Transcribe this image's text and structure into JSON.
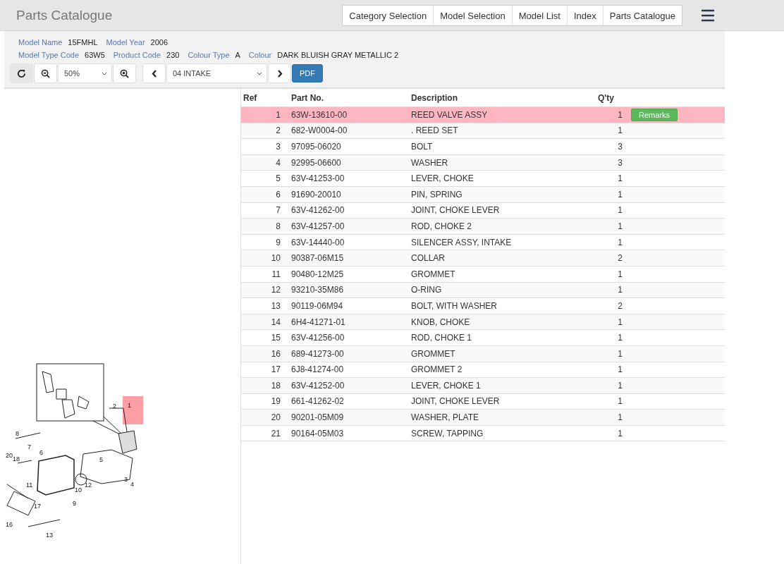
{
  "header": {
    "title": "Parts Catalogue",
    "nav": [
      {
        "label": "Category Selection"
      },
      {
        "label": "Model Selection"
      },
      {
        "label": "Model List"
      },
      {
        "label": "Index"
      },
      {
        "label": "Parts Catalogue"
      }
    ]
  },
  "info": {
    "lines": [
      [
        {
          "label": "Model Name",
          "value": "15FMHL"
        },
        {
          "label": "Model Year",
          "value": "2006"
        }
      ],
      [
        {
          "label": "Model Type Code",
          "value": "63W5"
        },
        {
          "label": "Product Code",
          "value": "230"
        },
        {
          "label": "Colour Type",
          "value": "A"
        },
        {
          "label": "Colour",
          "value": "DARK BLUISH GRAY METALLIC 2"
        }
      ]
    ]
  },
  "toolbar": {
    "zoom": "50%",
    "section": "04 INTAKE",
    "pdf": "PDF"
  },
  "diagram": {
    "callouts": [
      "1",
      "2",
      "3",
      "4",
      "5",
      "6",
      "7",
      "8",
      "9",
      "10",
      "11",
      "12",
      "13",
      "16",
      "17",
      "18",
      "20"
    ]
  },
  "table": {
    "columns": [
      "Ref",
      "Part No.",
      "Description",
      "Q'ty"
    ],
    "rows": [
      {
        "ref": "1",
        "part": "63W-13610-00",
        "description": "REED VALVE ASSY",
        "qty": "1",
        "selected": true,
        "action": "Remarks"
      },
      {
        "ref": "2",
        "part": "682-W0004-00",
        "description": ". REED SET",
        "qty": "1",
        "selected": false
      },
      {
        "ref": "3",
        "part": "97095-06020",
        "description": "BOLT",
        "qty": "3",
        "selected": false
      },
      {
        "ref": "4",
        "part": "92995-06600",
        "description": "WASHER",
        "qty": "3",
        "selected": false
      },
      {
        "ref": "5",
        "part": "63V-41253-00",
        "description": "LEVER, CHOKE",
        "qty": "1",
        "selected": false
      },
      {
        "ref": "6",
        "part": "91690-20010",
        "description": "PIN, SPRING",
        "qty": "1",
        "selected": false
      },
      {
        "ref": "7",
        "part": "63V-41262-00",
        "description": "JOINT, CHOKE LEVER",
        "qty": "1",
        "selected": false
      },
      {
        "ref": "8",
        "part": "63V-41257-00",
        "description": "ROD, CHOKE 2",
        "qty": "1",
        "selected": false
      },
      {
        "ref": "9",
        "part": "63V-14440-00",
        "description": "SILENCER ASSY, INTAKE",
        "qty": "1",
        "selected": false
      },
      {
        "ref": "10",
        "part": "90387-06M15",
        "description": "COLLAR",
        "qty": "2",
        "selected": false
      },
      {
        "ref": "11",
        "part": "90480-12M25",
        "description": "GROMMET",
        "qty": "1",
        "selected": false
      },
      {
        "ref": "12",
        "part": "93210-35M86",
        "description": "O-RING",
        "qty": "1",
        "selected": false
      },
      {
        "ref": "13",
        "part": "90119-06M94",
        "description": "BOLT, WITH WASHER",
        "qty": "2",
        "selected": false
      },
      {
        "ref": "14",
        "part": "6H4-41271-01",
        "description": "KNOB, CHOKE",
        "qty": "1",
        "selected": false
      },
      {
        "ref": "15",
        "part": "63V-41256-00",
        "description": "ROD, CHOKE 1",
        "qty": "1",
        "selected": false
      },
      {
        "ref": "16",
        "part": "689-41273-00",
        "description": "GROMMET",
        "qty": "1",
        "selected": false
      },
      {
        "ref": "17",
        "part": "6J8-41274-00",
        "description": "GROMMET 2",
        "qty": "1",
        "selected": false
      },
      {
        "ref": "18",
        "part": "63V-41252-00",
        "description": "LEVER, CHOKE 1",
        "qty": "1",
        "selected": false
      },
      {
        "ref": "19",
        "part": "661-41262-02",
        "description": "JOINT, CHOKE LEVER",
        "qty": "1",
        "selected": false
      },
      {
        "ref": "20",
        "part": "90201-05M09",
        "description": "WASHER, PLATE",
        "qty": "1",
        "selected": false
      },
      {
        "ref": "21",
        "part": "90164-05M03",
        "description": "SCREW, TAPPING",
        "qty": "1",
        "selected": false
      }
    ]
  }
}
